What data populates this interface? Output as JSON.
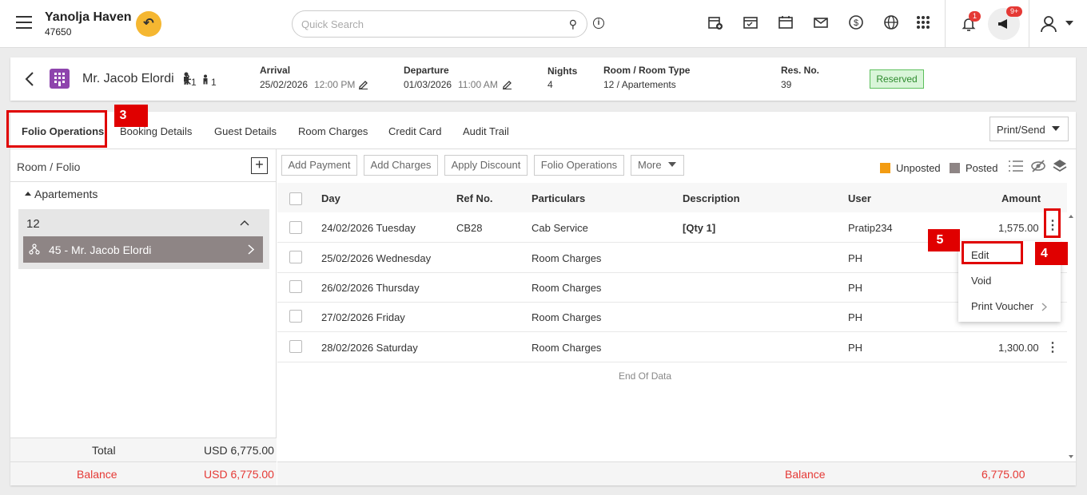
{
  "header": {
    "hotel_name": "Yanolja Haven",
    "hotel_id": "47650",
    "search_placeholder": "Quick Search",
    "notification_count": "1",
    "announcement_count": "9+"
  },
  "guest": {
    "name": "Mr. Jacob Elordi",
    "adults": "1",
    "children": "1",
    "arrival_label": "Arrival",
    "arrival_date": "25/02/2026",
    "arrival_time": "12:00 PM",
    "departure_label": "Departure",
    "departure_date": "01/03/2026",
    "departure_time": "11:00 AM",
    "nights_label": "Nights",
    "nights": "4",
    "room_label": "Room / Room Type",
    "room": "12 / Apartements",
    "resno_label": "Res. No.",
    "resno": "39",
    "status": "Reserved"
  },
  "tabs": [
    "Folio Operations",
    "Booking Details",
    "Guest Details",
    "Room Charges",
    "Credit Card",
    "Audit Trail"
  ],
  "print_send": "Print/Send",
  "annotations": {
    "tab": "3",
    "kebab": "4",
    "edit": "5"
  },
  "left": {
    "header": "Room / Folio",
    "group": "Apartements",
    "room": "12",
    "folio": "45 - Mr. Jacob Elordi",
    "total_label": "Total",
    "total_value": "USD 6,775.00",
    "balance_label": "Balance",
    "balance_value": "USD 6,775.00"
  },
  "toolbar": {
    "buttons": [
      "Add Payment",
      "Add Charges",
      "Apply Discount",
      "Folio Operations",
      "More"
    ],
    "unposted": "Unposted",
    "posted": "Posted",
    "unposted_color": "#f39c12",
    "posted_color": "#8e8585"
  },
  "table": {
    "columns": [
      "Day",
      "Ref No.",
      "Particulars",
      "Description",
      "User",
      "Amount"
    ],
    "rows": [
      {
        "day": "24/02/2026 Tuesday",
        "ref": "CB28",
        "particulars": "Cab Service",
        "description": "[Qty 1]",
        "user": "Pratip234",
        "amount": "1,575.00"
      },
      {
        "day": "25/02/2026 Wednesday",
        "ref": "",
        "particulars": "Room Charges",
        "description": "",
        "user": "PH",
        "amount": ""
      },
      {
        "day": "26/02/2026 Thursday",
        "ref": "",
        "particulars": "Room Charges",
        "description": "",
        "user": "PH",
        "amount": ""
      },
      {
        "day": "27/02/2026 Friday",
        "ref": "",
        "particulars": "Room Charges",
        "description": "",
        "user": "PH",
        "amount": ""
      },
      {
        "day": "28/02/2026 Saturday",
        "ref": "",
        "particulars": "Room Charges",
        "description": "",
        "user": "PH",
        "amount": "1,300.00"
      }
    ],
    "end_text": "End Of Data",
    "balance_label": "Balance",
    "balance_value": "6,775.00"
  },
  "context_menu": [
    "Edit",
    "Void",
    "Print Voucher"
  ]
}
